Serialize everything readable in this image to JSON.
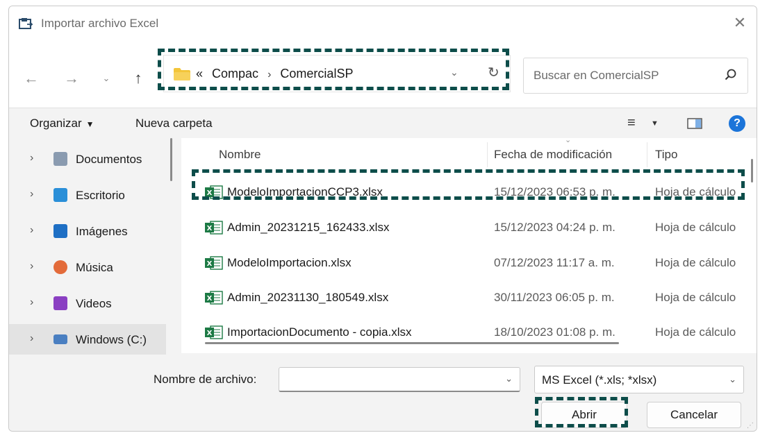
{
  "dialog": {
    "title": "Importar archivo Excel",
    "close_glyph": "✕"
  },
  "nav": {
    "back_glyph": "←",
    "forward_glyph": "→",
    "recent_glyph": "⌄",
    "up_glyph": "↑",
    "crumb_prefix": "«",
    "path": [
      "Compac",
      "ComercialSP"
    ],
    "path_sep": "›",
    "dropdown_glyph": "⌄",
    "refresh_glyph": "↻",
    "search_placeholder": "Buscar en ComercialSP"
  },
  "toolbar": {
    "organize": "Organizar",
    "organize_caret": "▼",
    "new_folder": "Nueva carpeta",
    "view_glyph": "≡",
    "view_caret": "▼",
    "help_glyph": "?"
  },
  "sidebar": {
    "items": [
      {
        "label": "Documentos",
        "icon": "documents-icon",
        "color": "#8a9bb0"
      },
      {
        "label": "Escritorio",
        "icon": "desktop-icon",
        "color": "#2a8fd8"
      },
      {
        "label": "Imágenes",
        "icon": "pictures-icon",
        "color": "#1e6fc4"
      },
      {
        "label": "Música",
        "icon": "music-icon",
        "color": "#e36b3a"
      },
      {
        "label": "Videos",
        "icon": "videos-icon",
        "color": "#8a3fc2"
      },
      {
        "label": "Windows (C:)",
        "icon": "drive-icon",
        "color": "#4a7fc1"
      }
    ],
    "chevron": "›"
  },
  "files": {
    "columns": [
      "Nombre",
      "Fecha de modificación",
      "Tipo"
    ],
    "sort_glyph": "⌄",
    "rows": [
      {
        "name": "ModeloImportacionCCP3.xlsx",
        "date": "15/12/2023 06:53 p. m.",
        "type": "Hoja de cálculo"
      },
      {
        "name": "Admin_20231215_162433.xlsx",
        "date": "15/12/2023 04:24 p. m.",
        "type": "Hoja de cálculo"
      },
      {
        "name": "ModeloImportacion.xlsx",
        "date": "07/12/2023 11:17 a. m.",
        "type": "Hoja de cálculo"
      },
      {
        "name": "Admin_20231130_180549.xlsx",
        "date": "30/11/2023 06:05 p. m.",
        "type": "Hoja de cálculo"
      },
      {
        "name": "ImportacionDocumento - copia.xlsx",
        "date": "18/10/2023 01:08 p. m.",
        "type": "Hoja de cálculo"
      }
    ]
  },
  "bottom": {
    "filename_label": "Nombre de archivo:",
    "filename_value": "",
    "filename_drop": "⌄",
    "filetype": "MS Excel (*.xls; *xlsx)",
    "filetype_drop": "⌄",
    "open": "Abrir",
    "cancel": "Cancelar"
  },
  "colors": {
    "highlight": "#0d4d4a",
    "excel_green": "#1d7a45",
    "folder_yellow": "#f3c53a",
    "help_blue": "#1b74d9"
  }
}
